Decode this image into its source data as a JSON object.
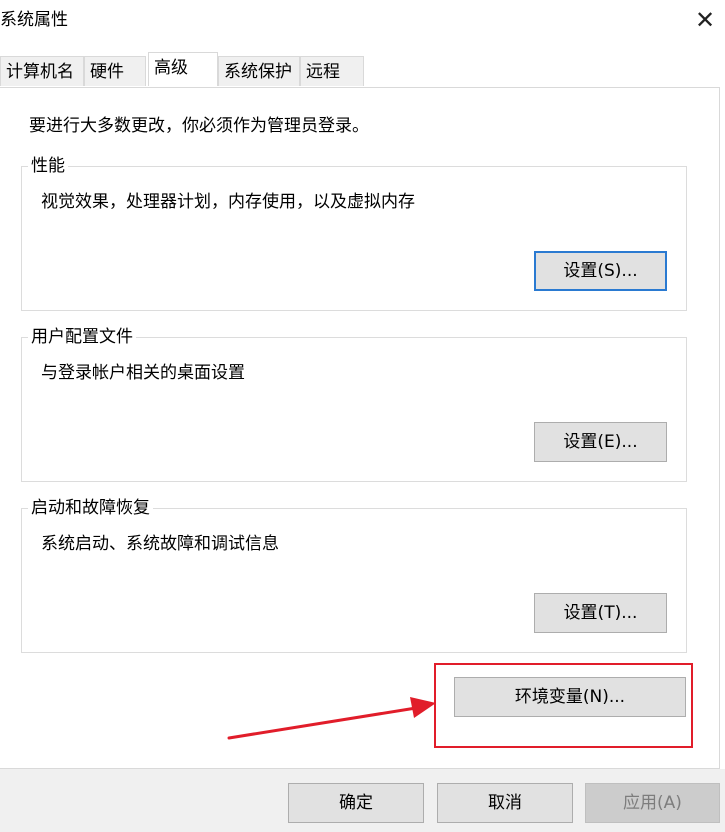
{
  "window": {
    "title": "系统属性",
    "close_glyph": "✕"
  },
  "tabs": [
    {
      "label": "计算机名",
      "active": false
    },
    {
      "label": "硬件",
      "active": false
    },
    {
      "label": "高级",
      "active": true
    },
    {
      "label": "系统保护",
      "active": false
    },
    {
      "label": "远程",
      "active": false
    }
  ],
  "advanced": {
    "intro": "要进行大多数更改，你必须作为管理员登录。",
    "performance": {
      "title": "性能",
      "description": "视觉效果，处理器计划，内存使用，以及虚拟内存",
      "button": "设置(S)..."
    },
    "user_profiles": {
      "title": "用户配置文件",
      "description": "与登录帐户相关的桌面设置",
      "button": "设置(E)..."
    },
    "startup_recovery": {
      "title": "启动和故障恢复",
      "description": "系统启动、系统故障和调试信息",
      "button": "设置(T)..."
    },
    "env_button": "环境变量(N)..."
  },
  "annotation": {
    "color": "#e11d2a",
    "arrow_icon": "arrow-right-icon"
  },
  "footer": {
    "ok": "确定",
    "cancel": "取消",
    "apply": "应用(A)"
  }
}
